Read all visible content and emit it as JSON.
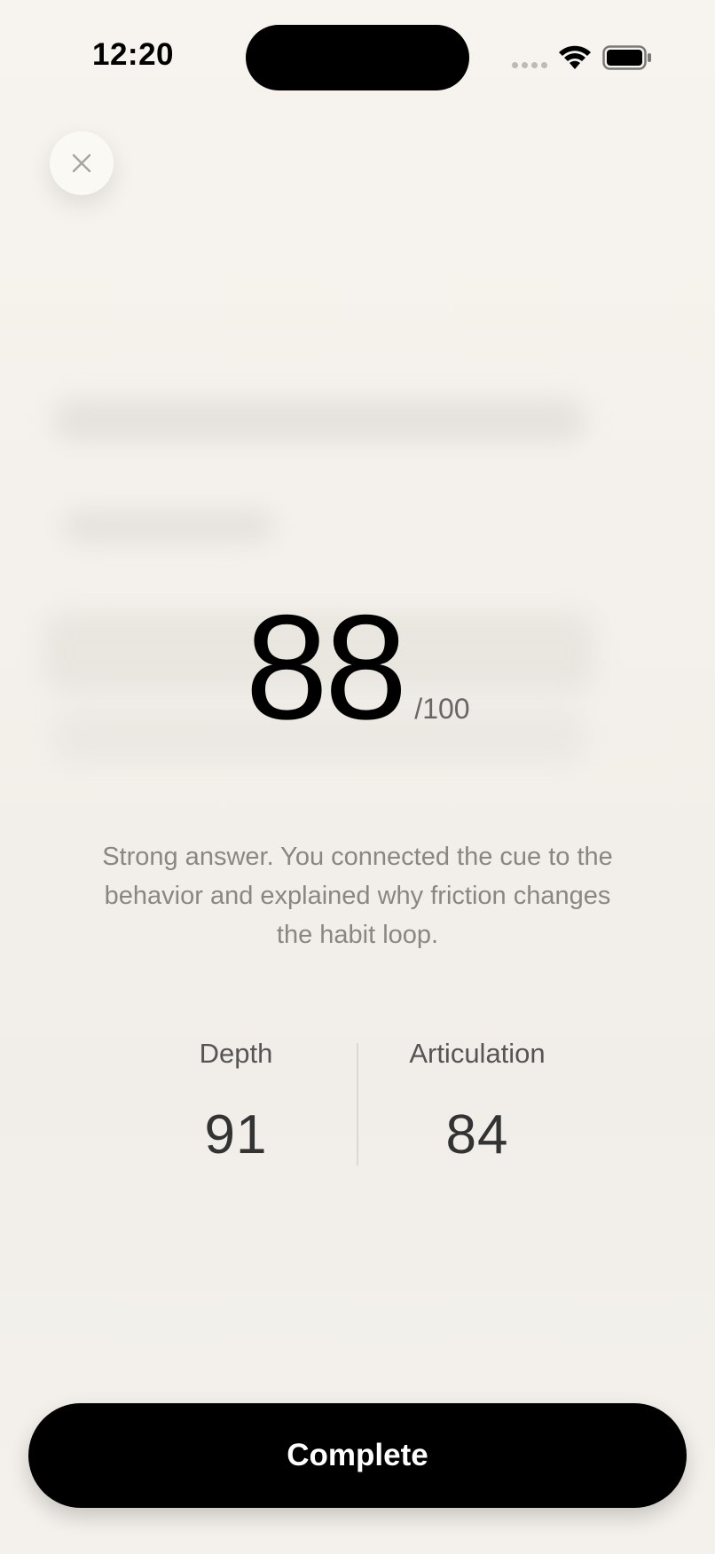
{
  "status_bar": {
    "time": "12:20",
    "icons": [
      "cellular-dots-icon",
      "wifi-icon",
      "battery-icon"
    ]
  },
  "close_button": {
    "icon": "close-icon"
  },
  "score": {
    "value": "88",
    "max_label": "/100"
  },
  "feedback": "Strong answer. You connected the cue to the behavior and explained why friction changes the habit loop.",
  "metrics": [
    {
      "label": "Depth",
      "value": "91"
    },
    {
      "label": "Articulation",
      "value": "84"
    }
  ],
  "complete_button": {
    "label": "Complete"
  },
  "colors": {
    "background": "#f4f1ec",
    "button": "#000000",
    "button_text": "#ffffff",
    "muted_text": "#8a8782"
  }
}
